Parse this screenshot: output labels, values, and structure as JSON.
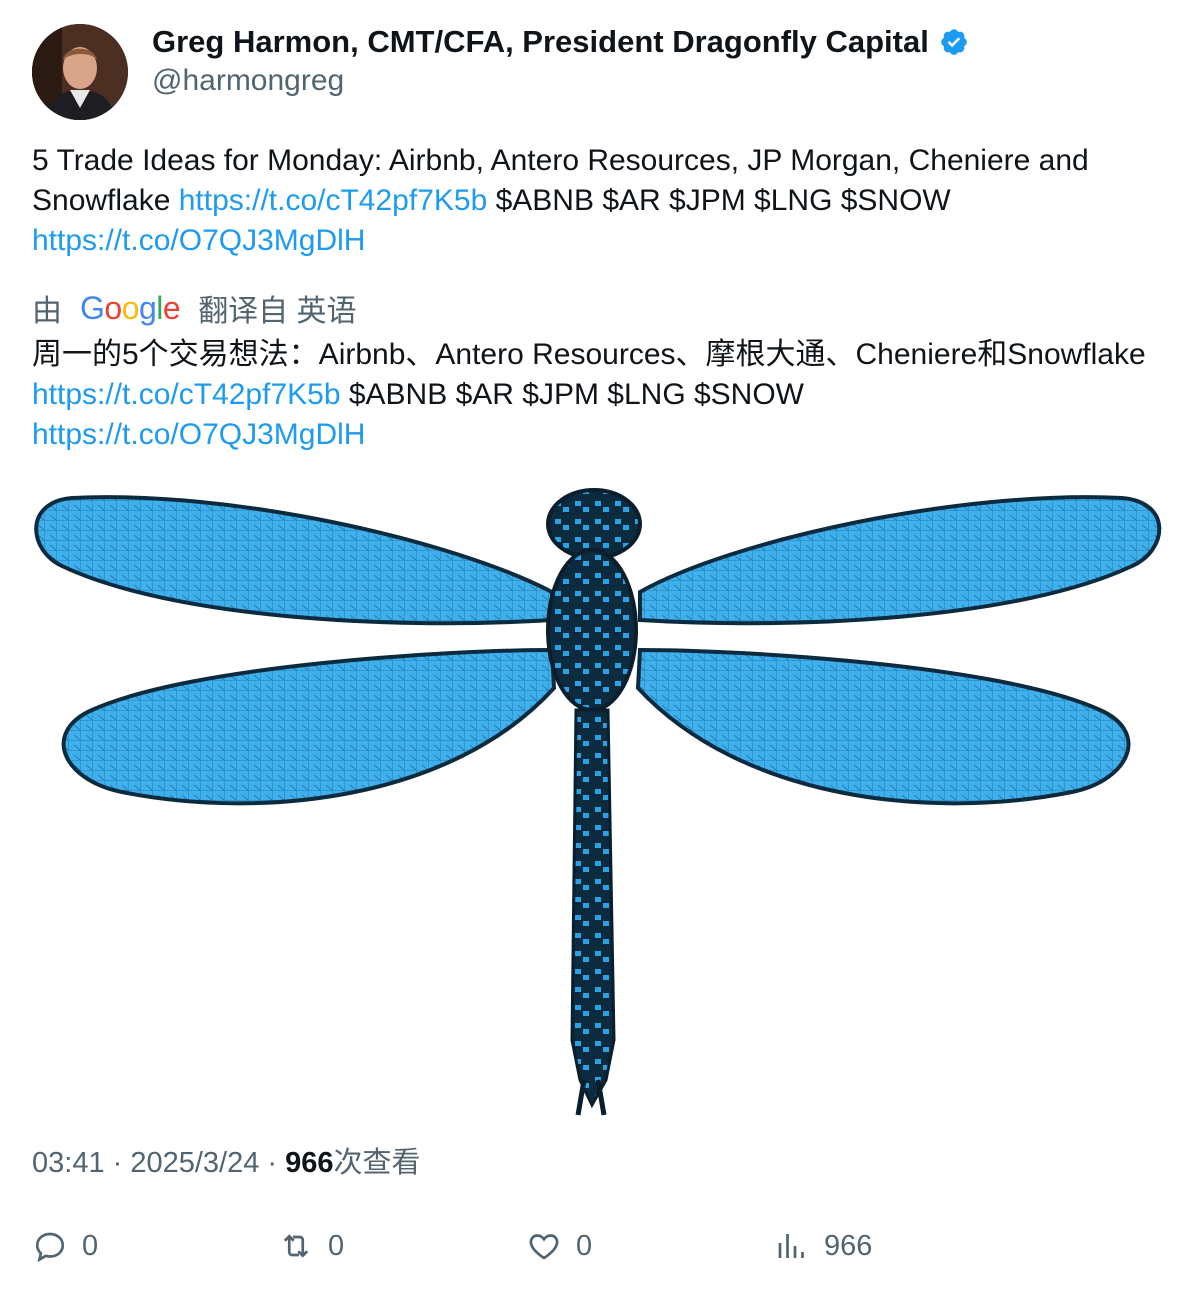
{
  "author": {
    "display_name": "Greg Harmon, CMT/CFA, President Dragonfly Capital",
    "handle": "@harmongreg",
    "verified_icon": "verified-badge-icon"
  },
  "tweet": {
    "text_part1": "5 Trade Ideas for Monday: Airbnb, Antero Resources, JP Morgan, Cheniere and Snowflake ",
    "link1": "https://t.co/cT42pf7K5b",
    "text_part2": " $ABNB $AR $JPM $LNG $SNOW",
    "link2": "https://t.co/O7QJ3MgDlH"
  },
  "translation": {
    "prefix": "由",
    "provider": "Google",
    "suffix": "翻译自 英语",
    "text_part1": "周一的5个交易想法：Airbnb、Antero Resources、摩根大通、Cheniere和Snowflake ",
    "link1": "https://t.co/cT42pf7K5b",
    "text_part2": " $ABNB $AR $JPM $LNG $SNOW",
    "link2": "https://t.co/O7QJ3MgDlH"
  },
  "meta": {
    "time": "03:41",
    "sep1": " · ",
    "date": "2025/3/24",
    "sep2": " · ",
    "views_count": "966",
    "views_label": "次查看"
  },
  "actions": {
    "reply_count": "0",
    "retweet_count": "0",
    "like_count": "0",
    "views_count": "966"
  },
  "colors": {
    "link": "#1d9bf0",
    "secondary_text": "#536471",
    "dragonfly_blue": "#2aa3e6"
  }
}
